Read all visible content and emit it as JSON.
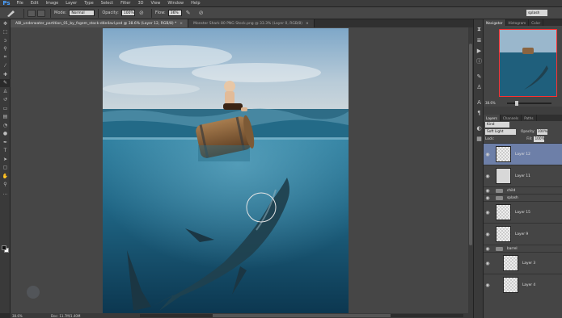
{
  "app": {
    "logo": "Ps"
  },
  "menu": [
    "File",
    "Edit",
    "Image",
    "Layer",
    "Type",
    "Select",
    "Filter",
    "3D",
    "View",
    "Window",
    "Help"
  ],
  "options": {
    "mode_label": "Mode:",
    "mode_value": "Normal",
    "opacity_label": "Opacity:",
    "opacity_value": "100%",
    "flow_label": "Flow:",
    "flow_value": "36%",
    "workspace": "splash"
  },
  "tabs": [
    {
      "label": "ABI_underwater_partition_01_by_fsgem_stock-d4e4avl.psd @ 38.6% (Layer 12, RGB/8) *"
    },
    {
      "label": "Monster Shark 80 PNG Stock.png @ 33.3% (Layer 0, RGB/8)"
    }
  ],
  "status": {
    "zoom": "38.6%",
    "doc": "Doc: 11.7M/1.40M"
  },
  "navigator": {
    "tabs": [
      "Navigator",
      "Histogram",
      "Color"
    ],
    "zoom": "38.6%"
  },
  "layers": {
    "tabs": [
      "Layers",
      "Channels",
      "Paths"
    ],
    "kind": "Kind",
    "blend": "Soft Light",
    "opacity_label": "Opacity:",
    "opacity_value": "100%",
    "lock_label": "Lock:",
    "fill_label": "Fill:",
    "fill_value": "100%",
    "items": [
      {
        "name": "Layer 12",
        "selected": true,
        "kind": "layer"
      },
      {
        "name": "Layer 11",
        "kind": "layer"
      },
      {
        "name": "child",
        "kind": "group"
      },
      {
        "name": "splash",
        "kind": "group"
      },
      {
        "name": "Layer 15",
        "kind": "layer"
      },
      {
        "name": "Layer 9",
        "kind": "layer"
      },
      {
        "name": "barrel",
        "kind": "group"
      },
      {
        "name": "Layer 3",
        "kind": "layer"
      },
      {
        "name": "Layer 4",
        "kind": "layer"
      }
    ]
  },
  "colors": {
    "accent": "#6d7fa8",
    "nav_frame": "#ff3030"
  },
  "icons": [
    "brush-icon",
    "eye-icon",
    "close-icon",
    "folder-icon"
  ]
}
